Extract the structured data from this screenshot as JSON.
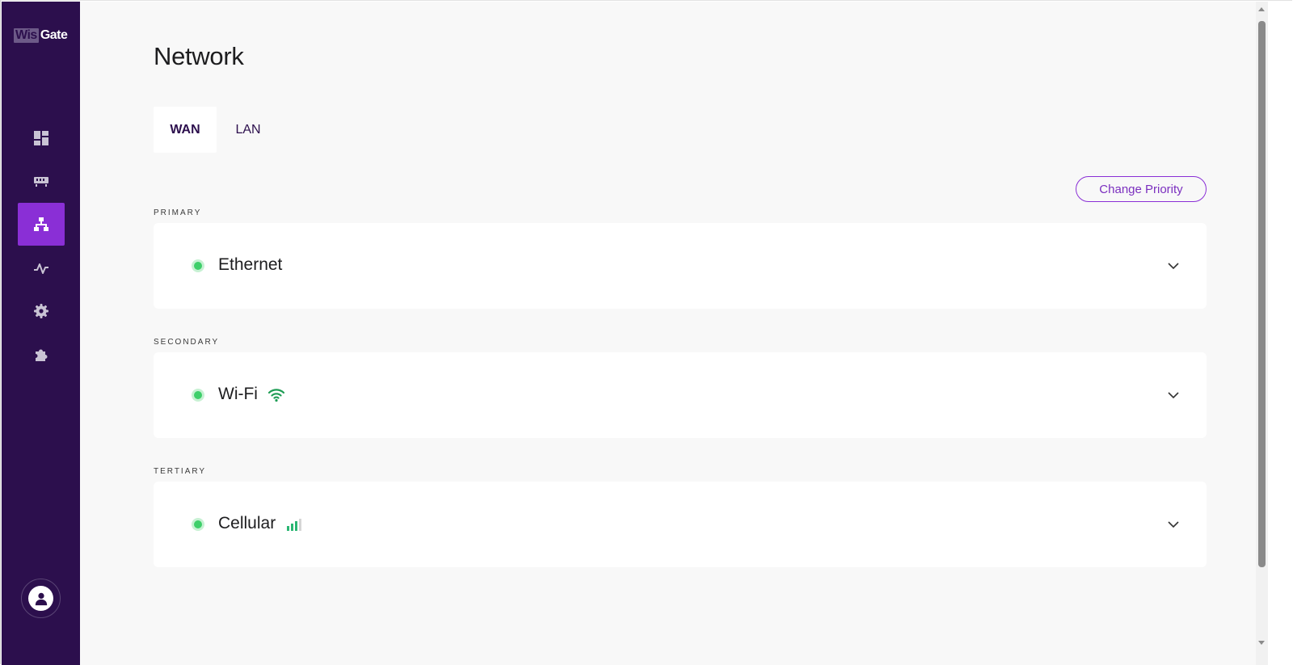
{
  "logo": {
    "part1": "Wis",
    "part2": "Gate"
  },
  "sidebar": {
    "items": [
      {
        "name": "dashboard",
        "icon": "dashboard-icon"
      },
      {
        "name": "devices",
        "icon": "gateway-icon"
      },
      {
        "name": "network",
        "icon": "network-icon",
        "active": true
      },
      {
        "name": "monitoring",
        "icon": "activity-icon"
      },
      {
        "name": "settings",
        "icon": "gear-icon"
      },
      {
        "name": "extensions",
        "icon": "puzzle-icon"
      }
    ],
    "user_icon": "user-icon"
  },
  "page": {
    "title": "Network"
  },
  "tabs": [
    {
      "label": "WAN",
      "active": true
    },
    {
      "label": "LAN",
      "active": false
    }
  ],
  "change_priority_label": "Change Priority",
  "sections": [
    {
      "label": "PRIMARY",
      "name": "Ethernet",
      "status": "connected",
      "signal_icon": null
    },
    {
      "label": "SECONDARY",
      "name": "Wi-Fi",
      "status": "connected",
      "signal_icon": "wifi-icon"
    },
    {
      "label": "TERTIARY",
      "name": "Cellular",
      "status": "connected",
      "signal_icon": "cellular-signal-icon",
      "signal_bars": 3,
      "signal_bars_max": 4
    }
  ],
  "colors": {
    "sidebar_bg": "#2c0f4d",
    "accent": "#8a2fd6",
    "status_green": "#3ecf6a",
    "signal_green": "#1f9d55"
  }
}
